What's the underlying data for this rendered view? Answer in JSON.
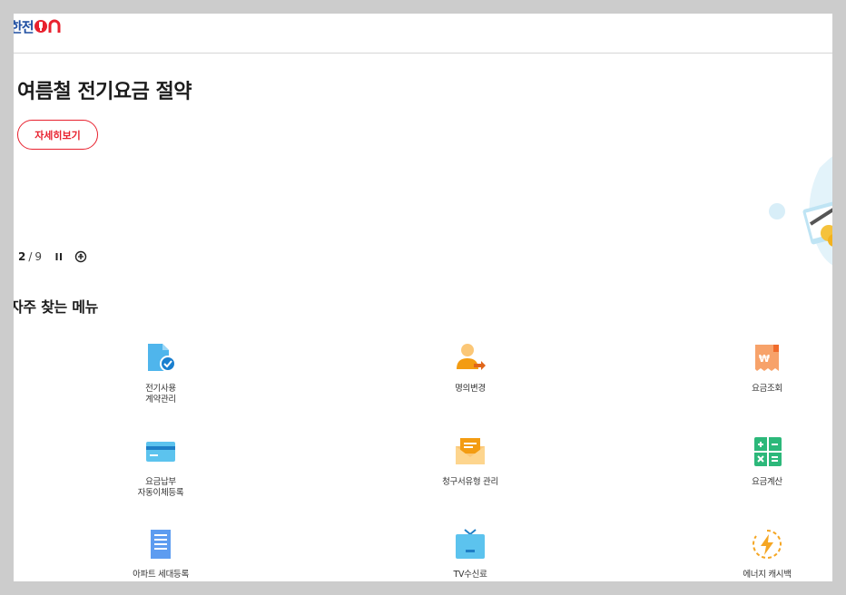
{
  "header": {
    "logo_text_kepco": "한전",
    "logo_text_on": "ON"
  },
  "hero": {
    "title": "여름철 전기요금 절약",
    "detail_button": "자세히보기"
  },
  "pager": {
    "current": "2",
    "separator": "/",
    "total": "9"
  },
  "menu": {
    "title": "자주 찾는 메뉴",
    "items": [
      {
        "label": "전기사용\n계약관리",
        "icon": "document-check-icon"
      },
      {
        "label": "명의변경",
        "icon": "person-change-icon"
      },
      {
        "label": "요금조회",
        "icon": "receipt-won-icon"
      },
      {
        "label": "요금납부\n자동이체등록",
        "icon": "credit-card-icon"
      },
      {
        "label": "청구서유형 관리",
        "icon": "envelope-bill-icon"
      },
      {
        "label": "요금계산",
        "icon": "calculator-icon"
      },
      {
        "label": "아파트 세대등록",
        "icon": "apartment-icon"
      },
      {
        "label": "TV수신료",
        "icon": "tv-icon"
      },
      {
        "label": "에너지 캐시백",
        "icon": "energy-cashback-icon"
      }
    ]
  },
  "colors": {
    "brand_blue": "#1f4ea1",
    "brand_red": "#e8212e",
    "icon_blue": "#4fb5ec",
    "icon_orange": "#f5a623",
    "icon_green": "#2cb87a"
  }
}
